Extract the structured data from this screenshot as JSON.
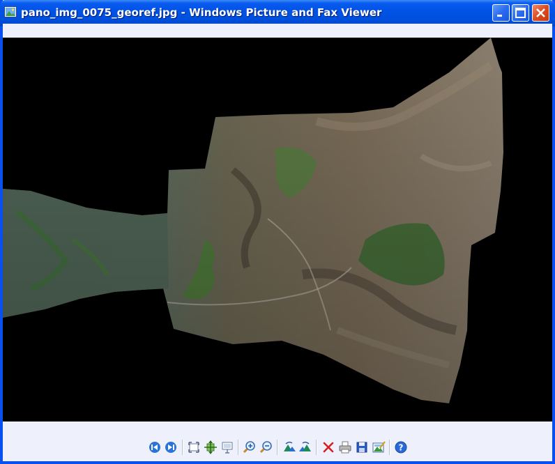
{
  "window": {
    "title": "pano_img_0075_georef.jpg - Windows Picture and Fax Viewer",
    "app_icon": "picture-viewer-icon",
    "controls": [
      "minimize-icon",
      "maximize-icon",
      "close-icon"
    ]
  },
  "image": {
    "subject": "aerial-panorama"
  },
  "toolbar": {
    "buttons": [
      {
        "name": "previous-image-button",
        "icon": "previous-icon"
      },
      {
        "name": "next-image-button",
        "icon": "next-icon"
      },
      {
        "name": "best-fit-button",
        "icon": "best-fit-icon"
      },
      {
        "name": "actual-size-button",
        "icon": "actual-size-icon"
      },
      {
        "name": "slideshow-button",
        "icon": "slideshow-icon"
      },
      {
        "name": "zoom-in-button",
        "icon": "zoom-in-icon"
      },
      {
        "name": "zoom-out-button",
        "icon": "zoom-out-icon"
      },
      {
        "name": "rotate-clockwise-button",
        "icon": "rotate-clockwise-icon"
      },
      {
        "name": "rotate-counterclockwise-button",
        "icon": "rotate-counterclockwise-icon"
      },
      {
        "name": "delete-button",
        "icon": "delete-icon"
      },
      {
        "name": "print-button",
        "icon": "print-icon"
      },
      {
        "name": "copy-to-button",
        "icon": "save-icon"
      },
      {
        "name": "open-for-editing-button",
        "icon": "edit-icon"
      },
      {
        "name": "help-button",
        "icon": "help-icon"
      }
    ]
  },
  "colors": {
    "titlebar": "#0053e6",
    "viewer_background": "#eef1fb",
    "image_background": "#000000",
    "close_button": "#dd4a20"
  }
}
